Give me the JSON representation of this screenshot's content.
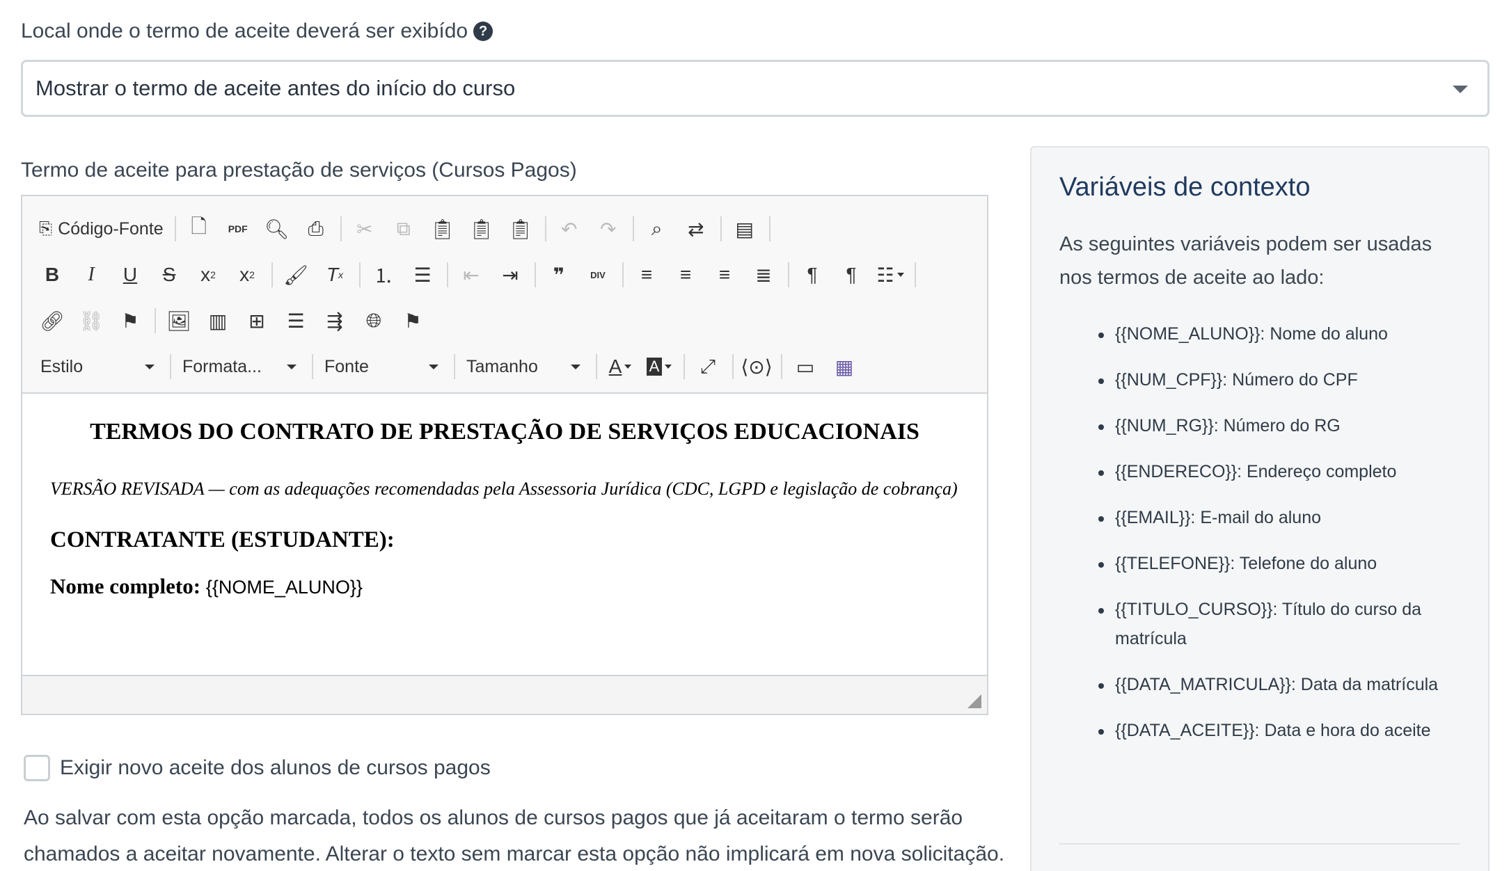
{
  "location": {
    "label": "Local onde o termo de aceite deverá ser exibído",
    "help_icon": "?",
    "selected": "Mostrar o termo de aceite antes do início do curso"
  },
  "editor": {
    "label": "Termo de aceite para prestação de serviços (Cursos Pagos)",
    "toolbar": {
      "source": "Código-Fonte",
      "style": "Estilo",
      "format": "Formata...",
      "font": "Fonte",
      "size": "Tamanho"
    },
    "content": {
      "title": "TERMOS DO CONTRATO DE PRESTAÇÃO DE SERVIÇOS EDUCACIONAIS",
      "version": "VERSÃO REVISADA — com as adequações recomendadas pela Assessoria Jurídica (CDC, LGPD e legislação de cobrança)",
      "section": "CONTRATANTE (ESTUDANTE):",
      "name_label": "Nome completo:",
      "name_value": "{{NOME_ALUNO}}"
    }
  },
  "reaccept": {
    "label": "Exigir novo aceite dos alunos de cursos pagos",
    "checked": false,
    "help": "Ao salvar com esta opção marcada, todos os alunos de cursos pagos que já aceitaram o termo serão chamados a aceitar novamente. Alterar o texto sem marcar esta opção não implicará em nova solicitação."
  },
  "context": {
    "title": "Variáveis de contexto",
    "description": "As seguintes variáveis podem ser usadas nos termos de aceite ao lado:",
    "variables": [
      "{{NOME_ALUNO}}: Nome do aluno",
      "{{NUM_CPF}}: Número do CPF",
      "{{NUM_RG}}: Número do RG",
      "{{ENDERECO}}: Endereço completo",
      "{{EMAIL}}: E-mail do aluno",
      "{{TELEFONE}}: Telefone do aluno",
      "{{TITULO_CURSO}}: Título do curso da matrícula",
      "{{DATA_MATRICULA}}: Data da matrícula",
      "{{DATA_ACEITE}}: Data e hora do aceite"
    ]
  }
}
